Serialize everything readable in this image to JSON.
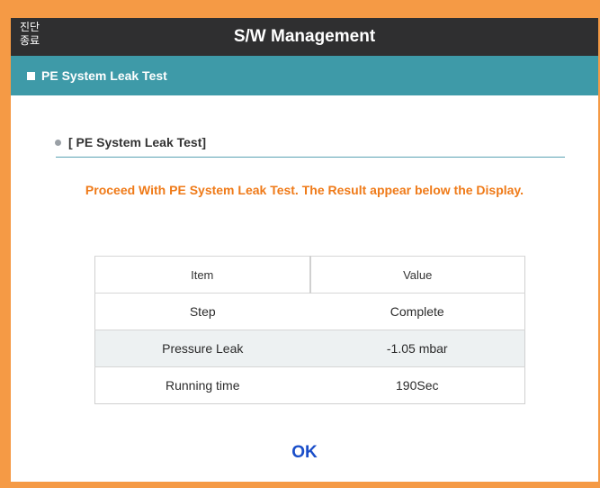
{
  "header": {
    "exit_line1": "진단",
    "exit_line2": "종료",
    "title": "S/W Management"
  },
  "section": {
    "title": "PE System Leak Test"
  },
  "content": {
    "sub_heading": "[ PE System Leak Test]",
    "message": "Proceed With PE System Leak Test. The Result appear below the Display."
  },
  "table": {
    "headers": [
      "Item",
      "Value"
    ],
    "rows": [
      {
        "item": "Step",
        "value": "Complete"
      },
      {
        "item": "Pressure Leak",
        "value": "-1.05 mbar"
      },
      {
        "item": "Running time",
        "value": "190Sec"
      }
    ]
  },
  "footer": {
    "ok_label": "OK"
  },
  "colors": {
    "outer_border": "#f59a45",
    "title_bar": "#2f2f30",
    "section_bar": "#3e9aa8",
    "message_text": "#ef7a18",
    "ok_text": "#1a4ec9"
  }
}
